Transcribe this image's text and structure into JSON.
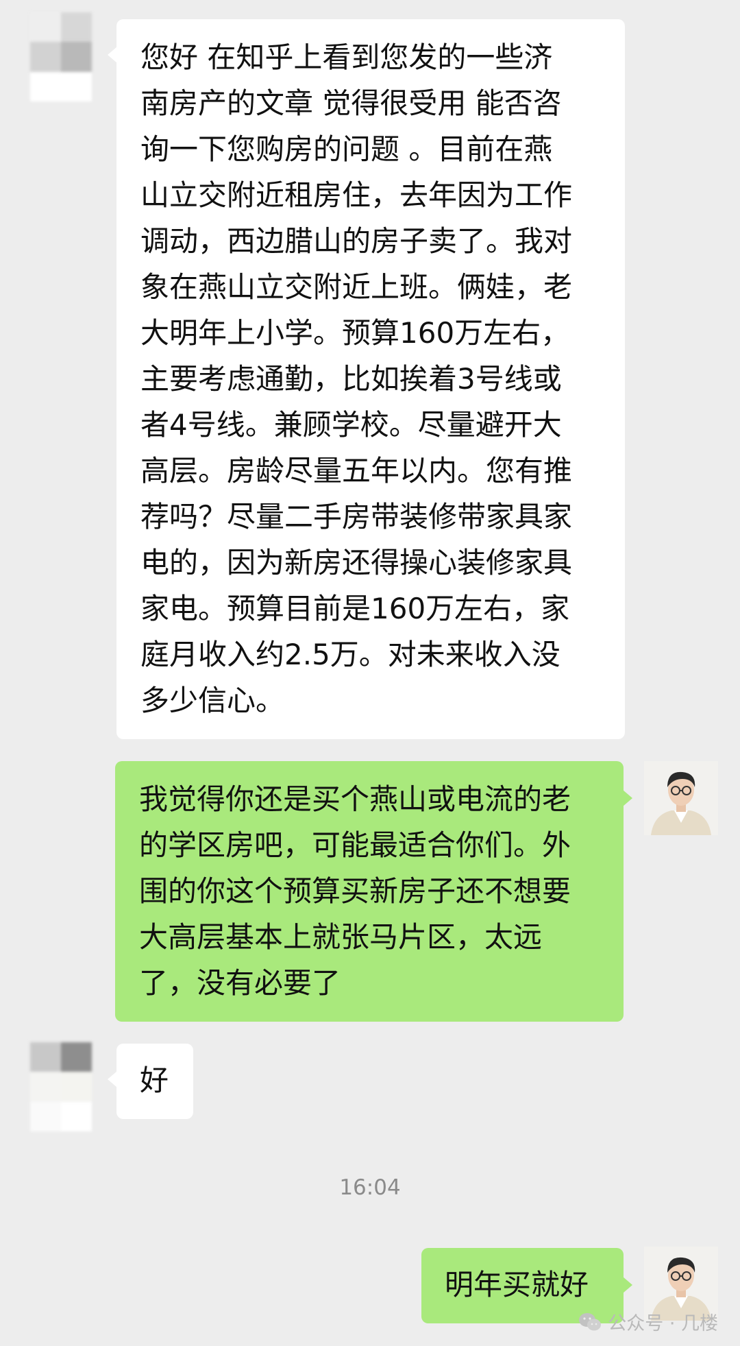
{
  "messages": [
    {
      "side": "left",
      "text": "您好 在知乎上看到您发的一些济\n南房产的文章 觉得很受用 能否咨\n询一下您购房的问题 。目前在燕\n山立交附近租房住，去年因为工作\n调动，西边腊山的房子卖了。我对\n象在燕山立交附近上班。俩娃，老\n大明年上小学。预算160万左右，\n主要考虑通勤，比如挨着3号线或\n者4号线。兼顾学校。尽量避开大\n高层。房龄尽量五年以内。您有推\n荐吗？尽量二手房带装修带家具家\n电的，因为新房还得操心装修家具\n家电。预算目前是160万左右，家\n庭月收入约2.5万。对未来收入没\n多少信心。"
    },
    {
      "side": "right",
      "text": "我觉得你还是买个燕山或电流的老\n的学区房吧，可能最适合你们。外\n围的你这个预算买新房子还不想要\n大高层基本上就张马片区，太远\n了，没有必要了"
    },
    {
      "side": "left",
      "text": "好"
    },
    {
      "side": "right",
      "text": "明年买就好"
    }
  ],
  "timestamp": "16:04",
  "watermark": {
    "text": "公众号 · 几楼",
    "icon": "wechat-icon"
  },
  "colors": {
    "background": "#ededed",
    "bubble_received": "#ffffff",
    "bubble_sent": "#a9e97c",
    "text": "#111111",
    "timestamp": "#8a8a8a"
  }
}
